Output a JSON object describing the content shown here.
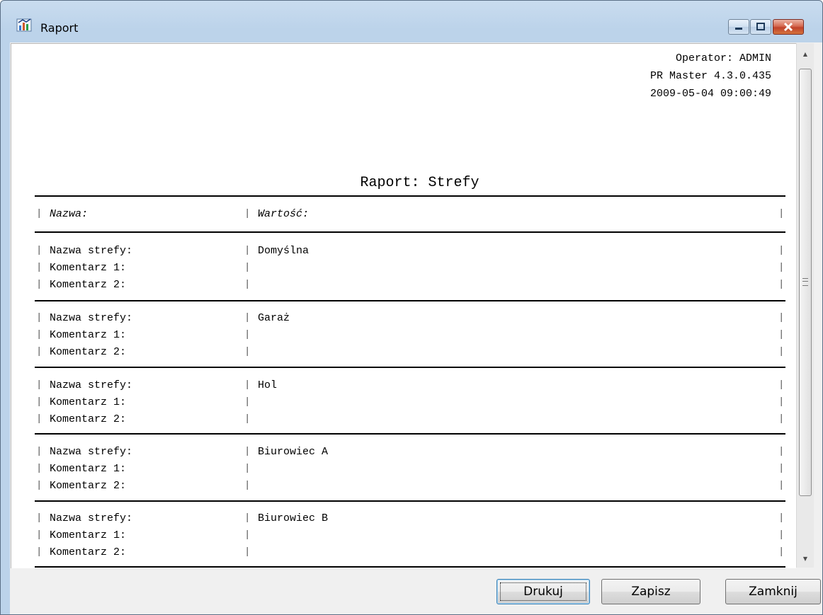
{
  "window": {
    "title": "Raport"
  },
  "report": {
    "header": [
      "Operator: ADMIN",
      "PR Master 4.3.0.435",
      "2009-05-04 09:00:49"
    ],
    "title": "Raport: Strefy",
    "columns": {
      "name": "Nazwa:",
      "value": "Wartość:"
    },
    "records": [
      {
        "zone_label": "Nazwa strefy:",
        "zone": "Domyślna",
        "c1_label": "Komentarz 1:",
        "c2_label": "Komentarz 2:"
      },
      {
        "zone_label": "Nazwa strefy:",
        "zone": "Garaż",
        "c1_label": "Komentarz 1:",
        "c2_label": "Komentarz 2:"
      },
      {
        "zone_label": "Nazwa strefy:",
        "zone": "Hol",
        "c1_label": "Komentarz 1:",
        "c2_label": "Komentarz 2:"
      },
      {
        "zone_label": "Nazwa strefy:",
        "zone": "Biurowiec A",
        "c1_label": "Komentarz 1:",
        "c2_label": "Komentarz 2:"
      },
      {
        "zone_label": "Nazwa strefy:",
        "zone": "Biurowiec B",
        "c1_label": "Komentarz 1:",
        "c2_label": "Komentarz 2:"
      }
    ]
  },
  "buttons": {
    "print": "Drukuj",
    "save": "Zapisz",
    "close": "Zamknij"
  }
}
